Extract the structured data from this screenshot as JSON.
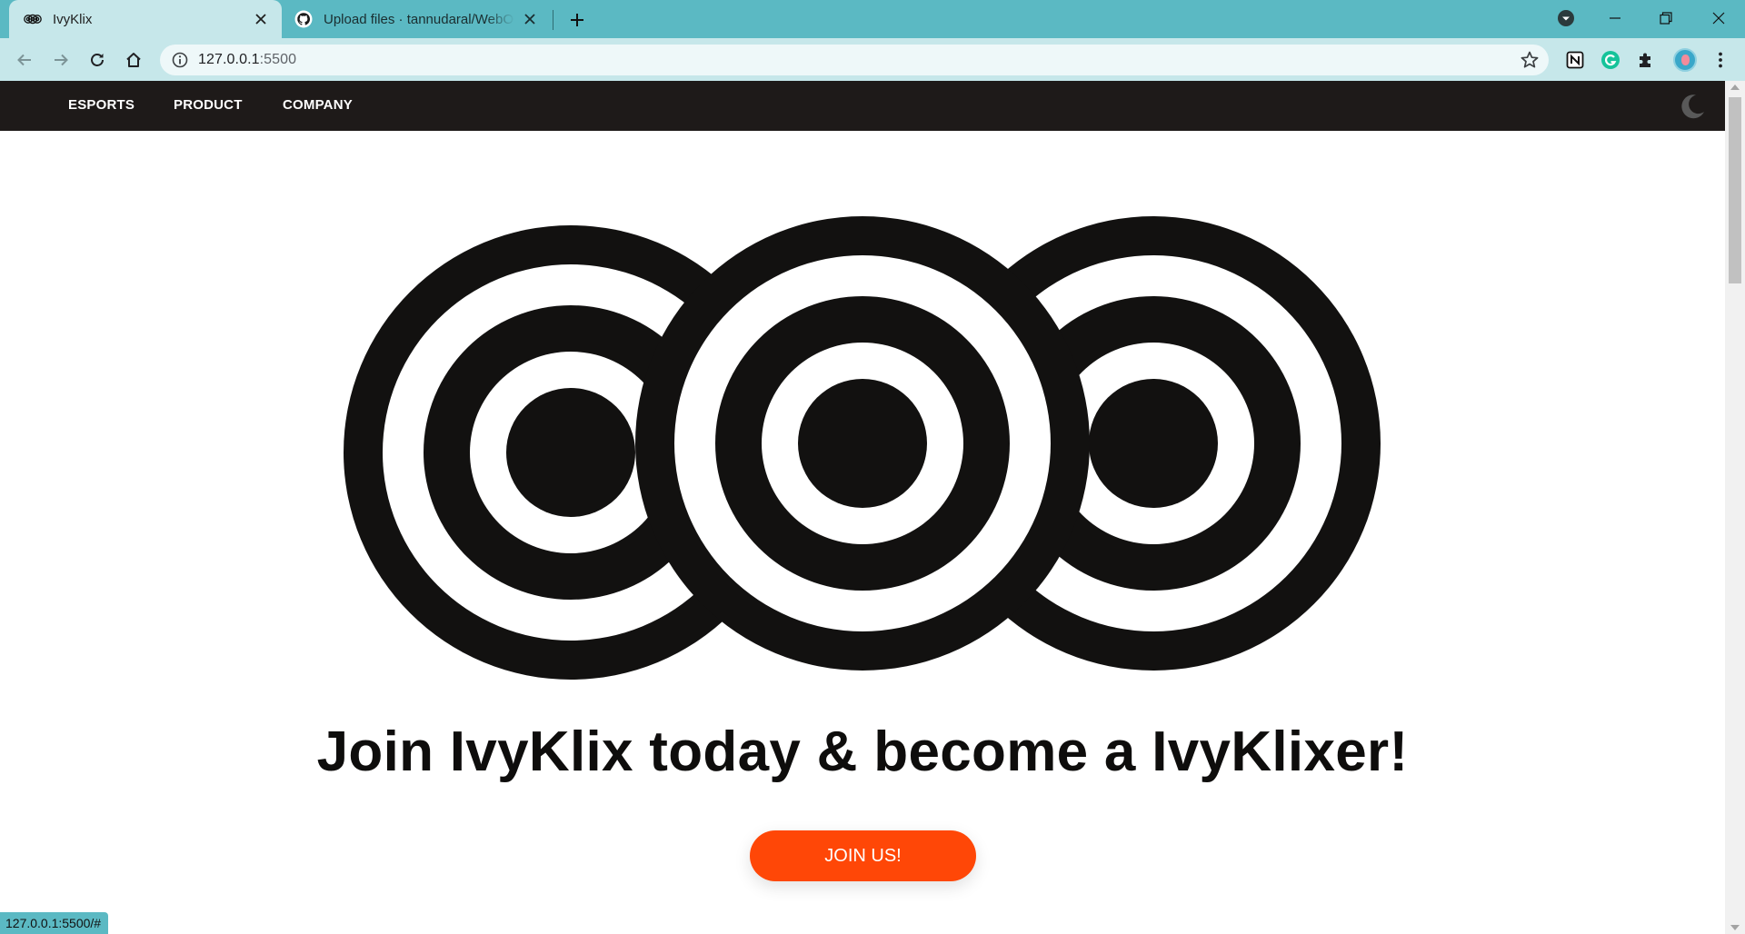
{
  "browser": {
    "tabs": [
      {
        "title": "IvyKlix",
        "active": true
      },
      {
        "title": "Upload files · tannudaral/WebOC",
        "active": false
      }
    ],
    "address": {
      "host": "127.0.0.1",
      "port": ":5500"
    },
    "colors": {
      "tabstrip": "#5bb9c3",
      "toolbar": "#c6e7ea"
    }
  },
  "site": {
    "nav": {
      "esports": "ESPORTS",
      "product": "PRODUCT",
      "company": "COMPANY"
    },
    "headline": "Join IvyKlix today & become a IvyKlixer!",
    "cta": "JOIN US!",
    "colors": {
      "nav_bg": "#1e1a19",
      "cta": "#ff4707",
      "logo": "#121110"
    }
  },
  "status_bar": {
    "text": "127.0.0.1:5500/#"
  }
}
